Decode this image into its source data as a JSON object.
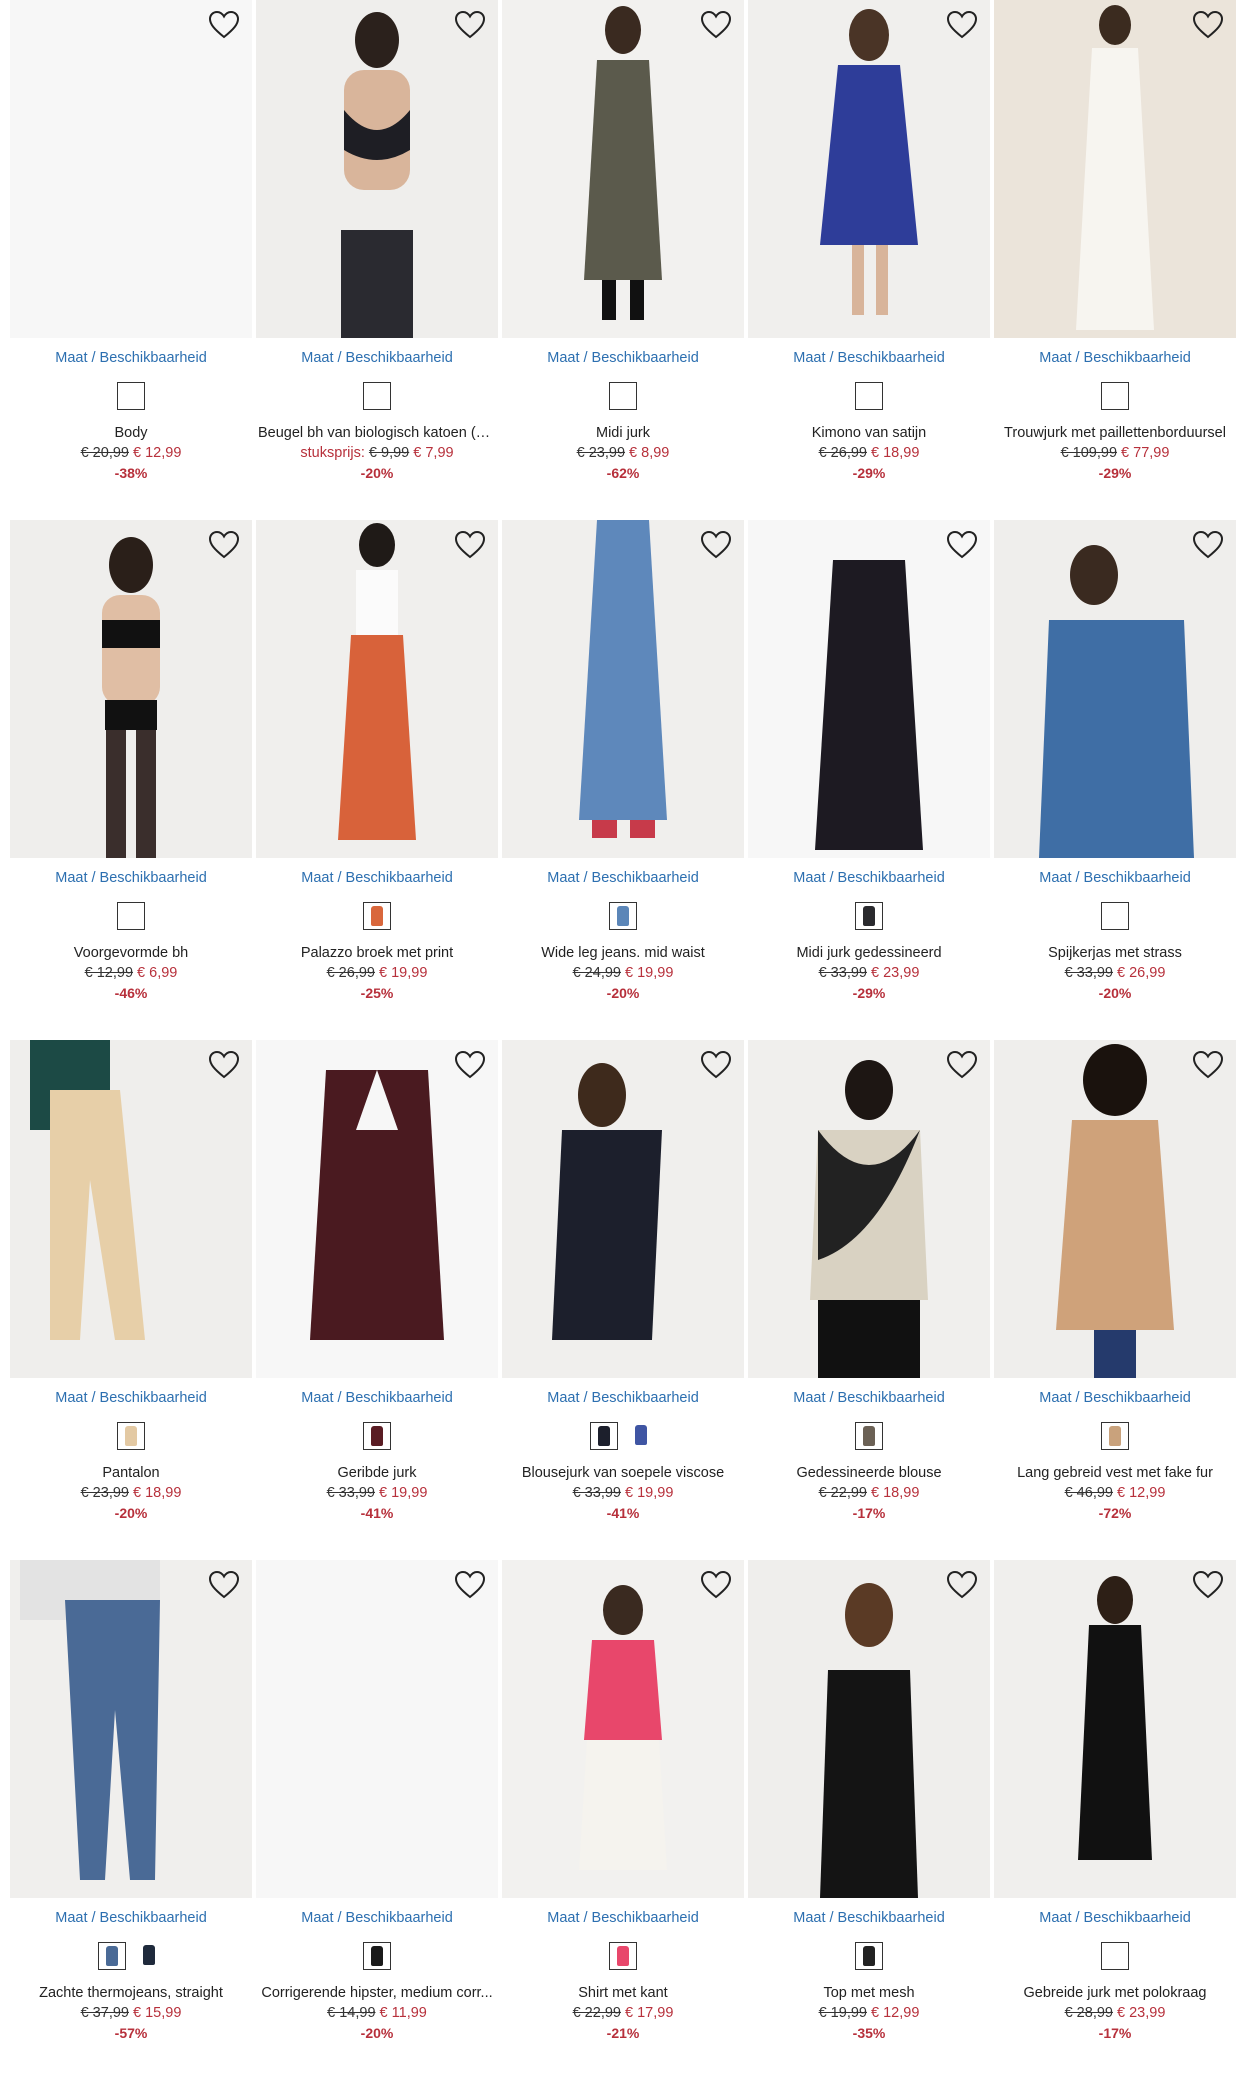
{
  "colors": {
    "link": "#2c6fb0",
    "sale": "#b7303b",
    "text": "#222222"
  },
  "size_link_label": "Maat / Beschikbaarheid",
  "heart_icon": "heart-outline-icon",
  "products": [
    {
      "name": "Body",
      "unit_label": "",
      "old_price": "€ 20,99",
      "new_price": "€ 12,99",
      "discount": "-38%",
      "bg": "#f7f7f7",
      "swatches": [
        {
          "type": "empty"
        }
      ]
    },
    {
      "name": "Beugel bh van biologisch katoen (se...",
      "unit_label": "stuksprijs:",
      "old_price": "€ 9,99",
      "new_price": "€ 7,99",
      "discount": "-20%",
      "bg": "#efeeec",
      "swatches": [
        {
          "type": "empty"
        }
      ]
    },
    {
      "name": "Midi jurk",
      "unit_label": "",
      "old_price": "€ 23,99",
      "new_price": "€ 8,99",
      "discount": "-62%",
      "bg": "#f2f1ef",
      "swatches": [
        {
          "type": "empty"
        }
      ]
    },
    {
      "name": "Kimono van satijn",
      "unit_label": "",
      "old_price": "€ 26,99",
      "new_price": "€ 18,99",
      "discount": "-29%",
      "bg": "#f0efed",
      "swatches": [
        {
          "type": "empty"
        }
      ]
    },
    {
      "name": "Trouwjurk met paillettenborduursel",
      "unit_label": "",
      "old_price": "€ 109,99",
      "new_price": "€ 77,99",
      "discount": "-29%",
      "bg": "#ebe4da",
      "swatches": [
        {
          "type": "empty"
        }
      ]
    },
    {
      "name": "Voorgevormde bh",
      "unit_label": "",
      "old_price": "€ 12,99",
      "new_price": "€ 6,99",
      "discount": "-46%",
      "bg": "#efeeec",
      "swatches": [
        {
          "type": "empty"
        }
      ]
    },
    {
      "name": "Palazzo broek met print",
      "unit_label": "",
      "old_price": "€ 26,99",
      "new_price": "€ 19,99",
      "discount": "-25%",
      "bg": "#f0efed",
      "swatches": [
        {
          "type": "sel",
          "color": "#d9673c"
        }
      ]
    },
    {
      "name": "Wide leg jeans. mid waist",
      "unit_label": "",
      "old_price": "€ 24,99",
      "new_price": "€ 19,99",
      "discount": "-20%",
      "bg": "#f0efed",
      "swatches": [
        {
          "type": "sel",
          "color": "#5b86b8"
        }
      ]
    },
    {
      "name": "Midi jurk gedessineerd",
      "unit_label": "",
      "old_price": "€ 33,99",
      "new_price": "€ 23,99",
      "discount": "-29%",
      "bg": "#f7f7f7",
      "swatches": [
        {
          "type": "sel",
          "color": "#2a2a2e"
        }
      ]
    },
    {
      "name": "Spijkerjas met strass",
      "unit_label": "",
      "old_price": "€ 33,99",
      "new_price": "€ 26,99",
      "discount": "-20%",
      "bg": "#efeeec",
      "swatches": [
        {
          "type": "empty"
        }
      ]
    },
    {
      "name": "Pantalon",
      "unit_label": "",
      "old_price": "€ 23,99",
      "new_price": "€ 18,99",
      "discount": "-20%",
      "bg": "#efeeec",
      "swatches": [
        {
          "type": "sel",
          "color": "#e3c9a3"
        }
      ]
    },
    {
      "name": "Geribde jurk",
      "unit_label": "",
      "old_price": "€ 33,99",
      "new_price": "€ 19,99",
      "discount": "-41%",
      "bg": "#f7f7f7",
      "swatches": [
        {
          "type": "sel",
          "color": "#5a1c23"
        }
      ]
    },
    {
      "name": "Blousejurk van soepele viscose",
      "unit_label": "",
      "old_price": "€ 33,99",
      "new_price": "€ 19,99",
      "discount": "-41%",
      "bg": "#f0efed",
      "swatches": [
        {
          "type": "sel",
          "color": "#1c1f2c"
        },
        {
          "type": "plain",
          "color": "#3f55a3"
        }
      ]
    },
    {
      "name": "Gedessineerde blouse",
      "unit_label": "",
      "old_price": "€ 22,99",
      "new_price": "€ 18,99",
      "discount": "-17%",
      "bg": "#f0efed",
      "swatches": [
        {
          "type": "sel",
          "color": "#6b6155"
        }
      ]
    },
    {
      "name": "Lang gebreid vest met fake fur",
      "unit_label": "",
      "old_price": "€ 46,99",
      "new_price": "€ 12,99",
      "discount": "-72%",
      "bg": "#efeeec",
      "swatches": [
        {
          "type": "sel",
          "color": "#c9a27c"
        }
      ]
    },
    {
      "name": "Zachte thermojeans, straight",
      "unit_label": "",
      "old_price": "€ 37,99",
      "new_price": "€ 15,99",
      "discount": "-57%",
      "bg": "#f0efed",
      "swatches": [
        {
          "type": "sel",
          "color": "#4a6a96"
        },
        {
          "type": "plain",
          "color": "#1f2a3c"
        }
      ]
    },
    {
      "name": "Corrigerende hipster, medium corr...",
      "unit_label": "",
      "old_price": "€ 14,99",
      "new_price": "€ 11,99",
      "discount": "-20%",
      "bg": "#f7f7f7",
      "swatches": [
        {
          "type": "sel",
          "color": "#1b1b1b"
        }
      ]
    },
    {
      "name": "Shirt met kant",
      "unit_label": "",
      "old_price": "€ 22,99",
      "new_price": "€ 17,99",
      "discount": "-21%",
      "bg": "#f2f1ef",
      "swatches": [
        {
          "type": "sel",
          "color": "#e8476b"
        }
      ]
    },
    {
      "name": "Top met mesh",
      "unit_label": "",
      "old_price": "€ 19,99",
      "new_price": "€ 12,99",
      "discount": "-35%",
      "bg": "#efeeec",
      "swatches": [
        {
          "type": "sel",
          "color": "#222222"
        }
      ]
    },
    {
      "name": "Gebreide jurk met polokraag",
      "unit_label": "",
      "old_price": "€ 28,99",
      "new_price": "€ 23,99",
      "discount": "-17%",
      "bg": "#f0efed",
      "swatches": [
        {
          "type": "empty"
        }
      ]
    }
  ]
}
